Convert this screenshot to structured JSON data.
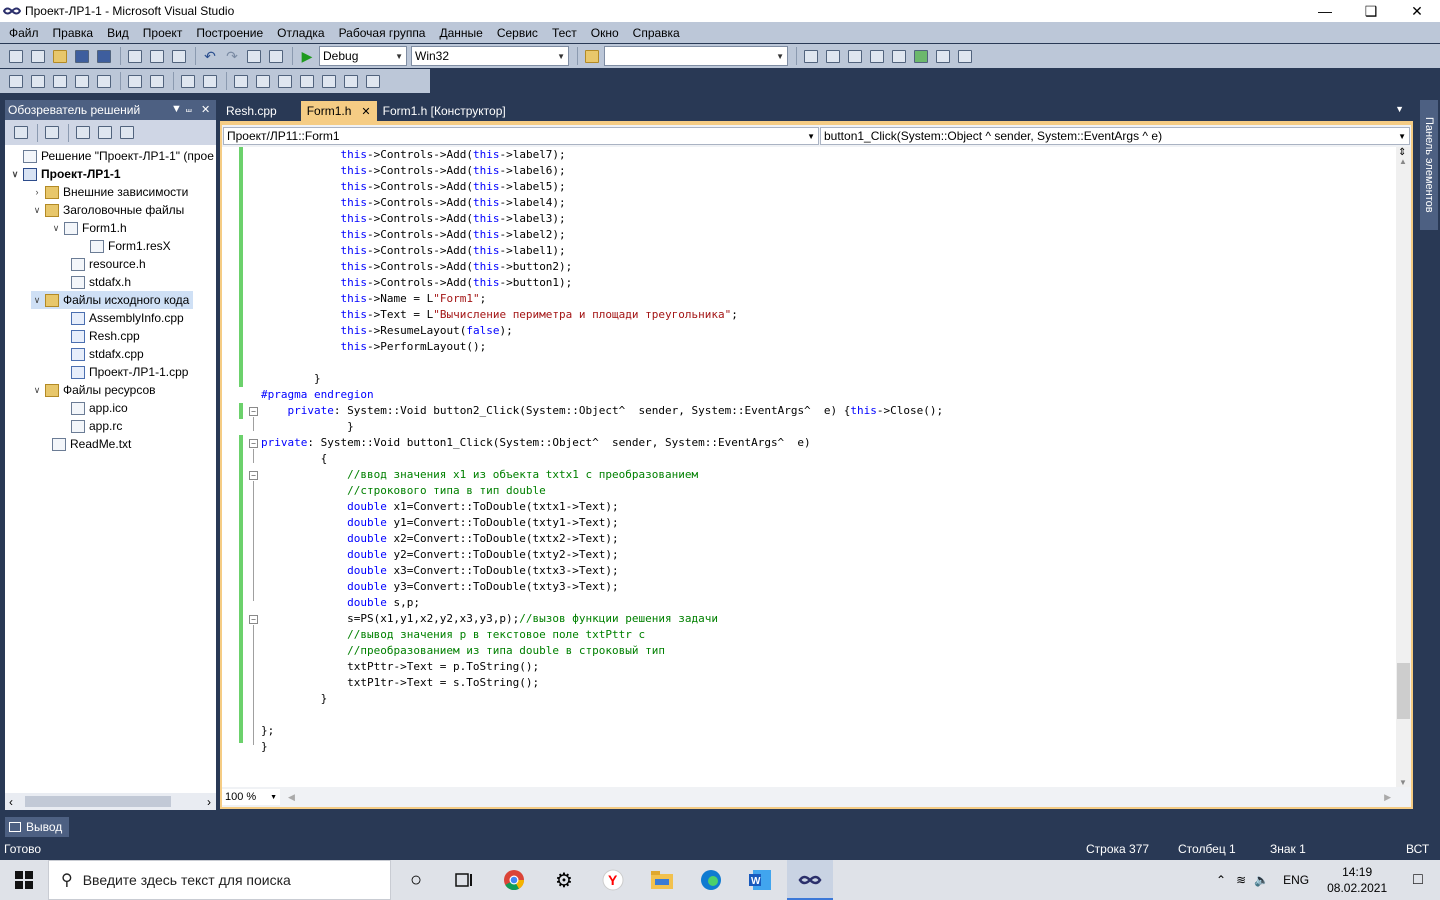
{
  "window": {
    "title": "Проект-ЛР1-1 - Microsoft Visual Studio"
  },
  "menu": [
    "Файл",
    "Правка",
    "Вид",
    "Проект",
    "Построение",
    "Отладка",
    "Рабочая группа",
    "Данные",
    "Сервис",
    "Тест",
    "Окно",
    "Справка"
  ],
  "toolbar": {
    "config": "Debug",
    "platform": "Win32",
    "find": ""
  },
  "solution_explorer": {
    "title": "Обозреватель решений",
    "nodes": [
      {
        "label": "Решение \"Проект-ЛР1-1\"  (прое",
        "icon": "solution-icon"
      },
      {
        "label": "Проект-ЛР1-1",
        "icon": "project-icon"
      },
      {
        "label": "Внешние зависимости",
        "icon": "folder-icon"
      },
      {
        "label": "Заголовочные файлы",
        "icon": "folder-icon"
      },
      {
        "label": "Form1.h",
        "icon": "form-icon"
      },
      {
        "label": "Form1.resX",
        "icon": "resx-icon"
      },
      {
        "label": "resource.h",
        "icon": "header-file-icon"
      },
      {
        "label": "stdafx.h",
        "icon": "header-file-icon"
      },
      {
        "label": "Файлы исходного кода",
        "icon": "folder-icon"
      },
      {
        "label": "AssemblyInfo.cpp",
        "icon": "cpp-file-icon"
      },
      {
        "label": "Resh.cpp",
        "icon": "cpp-file-icon"
      },
      {
        "label": "stdafx.cpp",
        "icon": "cpp-file-icon"
      },
      {
        "label": "Проект-ЛР1-1.cpp",
        "icon": "cpp-file-icon"
      },
      {
        "label": "Файлы ресурсов",
        "icon": "folder-icon"
      },
      {
        "label": "app.ico",
        "icon": "ico-file-icon"
      },
      {
        "label": "app.rc",
        "icon": "rc-file-icon"
      },
      {
        "label": "ReadMe.txt",
        "icon": "txt-file-icon"
      }
    ]
  },
  "tabs": [
    "Resh.cpp",
    "Form1.h",
    "Form1.h [Конструктор]"
  ],
  "nav": {
    "class": "Проект/ЛР11::Form1",
    "member": "button1_Click(System::Object ^ sender, System::EventArgs ^ e)"
  },
  "code": [
    "            this->Controls->Add(this->label7);",
    "            this->Controls->Add(this->label6);",
    "            this->Controls->Add(this->label5);",
    "            this->Controls->Add(this->label4);",
    "            this->Controls->Add(this->label3);",
    "            this->Controls->Add(this->label2);",
    "            this->Controls->Add(this->label1);",
    "            this->Controls->Add(this->button2);",
    "            this->Controls->Add(this->button1);",
    "            this->Name = L\"Form1\";",
    "            this->Text = L\"Вычисление периметра и площади треугольника\";",
    "            this->ResumeLayout(false);",
    "            this->PerformLayout();",
    "",
    "        }",
    "#pragma endregion",
    "    private: System::Void button2_Click(System::Object^  sender, System::EventArgs^  e) {this->Close();",
    "             }",
    "private: System::Void button1_Click(System::Object^  sender, System::EventArgs^  e)",
    "         {",
    "             //ввод значения x1 из объекта txtx1 с преобразованием",
    "             //строкового типа в тип double",
    "             double x1=Convert::ToDouble(txtx1->Text);",
    "             double y1=Convert::ToDouble(txty1->Text);",
    "             double x2=Convert::ToDouble(txtx2->Text);",
    "             double y2=Convert::ToDouble(txty2->Text);",
    "             double x3=Convert::ToDouble(txtx3->Text);",
    "             double y3=Convert::ToDouble(txty3->Text);",
    "             double s,p;",
    "             s=PS(x1,y1,x2,y2,x3,y3,p);//вызов функции решения задачи",
    "             //вывод значения p в текстовое поле txtPttr с",
    "             //преобразованием из типа double в строковый тип",
    "             txtPttr->Text = p.ToString();",
    "             txtP1tr->Text = s.ToString();",
    "         }",
    "",
    "};",
    "}"
  ],
  "zoom": "100 %",
  "toolbox_tab": "Панель элементов",
  "output_tab": "Вывод",
  "status": {
    "ready": "Готово",
    "line": "Строка 377",
    "col": "Столбец 1",
    "char": "Знак 1",
    "mode": "ВСТ"
  },
  "taskbar": {
    "search_placeholder": "Введите здесь текст для поиска",
    "lang": "ENG",
    "time": "14:19",
    "date": "08.02.2021"
  }
}
